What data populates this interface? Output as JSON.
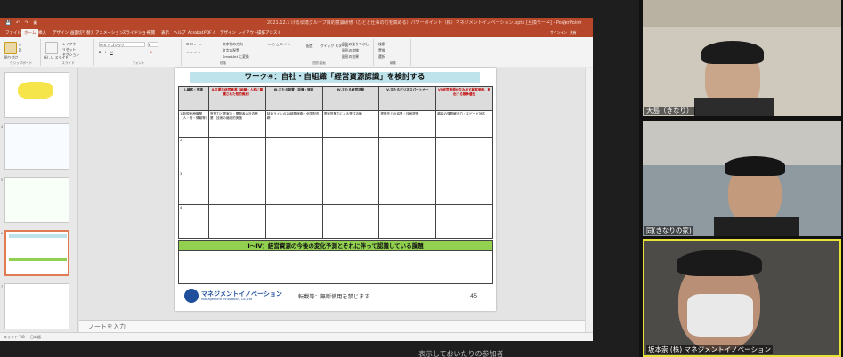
{
  "ppt": {
    "title_text": "2021.12.1 ける伝達グループ目的意識研修（ひとと仕事の力を高める）パワーポイント（株）マネジメントイノベーション.pptx [互換モード] - PowerPoint",
    "tabs": [
      "ファイル",
      "ホーム",
      "挿入",
      "デザイン",
      "画面切り替え",
      "アニメーション",
      "スライドショー",
      "校閲",
      "表示",
      "ヘルプ",
      "Acrobat",
      "PDF 4",
      "デザイン",
      "レイアウト",
      "操作アシスト"
    ],
    "active_tab": "ホーム",
    "ribbon": {
      "paste": "貼り付け",
      "clipboard": "クリップボード",
      "new_slide": "新しい スライド",
      "layout": "レイアウト",
      "reset": "リセット",
      "section": "セクション",
      "slides_group": "スライド",
      "font_name": "ＭＳ Ｐゴシック",
      "font_size": "6",
      "font_group": "フォント",
      "paragraph_group": "段落",
      "text_direction": "文字列の方向",
      "align_text": "文字の配置",
      "smartart": "SmartArt に変換",
      "drawing_group": "図形描画",
      "arrange": "配置",
      "quick_styles": "クイック スタイル",
      "shape_fill": "図形の塗りつぶし",
      "shape_outline": "図形の枠線",
      "shape_effects": "図形の効果",
      "find": "検索",
      "replace": "置換",
      "select": "選択",
      "editing_group": "編集",
      "share": "共有",
      "signin": "サインイン"
    },
    "notes_placeholder": "ノートを入力",
    "status": {
      "slide_info": "スライド 7/8",
      "lang": "日本語"
    },
    "thumb_numbers": [
      "4",
      "5",
      "6",
      "7",
      "8"
    ]
  },
  "slide": {
    "title": "ワーク④：自社・自組織「経営資源認識」を検討する",
    "headers": [
      {
        "text": "Ⅰ.顧客・市場",
        "red": false
      },
      {
        "text": "Ⅱ.主要な経営資源（組織・人材に蓄積された知的資産）",
        "red": true
      },
      {
        "text": "Ⅲ.主たる装置・設備・施設",
        "red": false
      },
      {
        "text": "Ⅳ.主たる経営活動",
        "red": false
      },
      {
        "text": "Ⅴ.主たるビジネスパートナー",
        "red": false
      },
      {
        "text": "Ⅵ.経営資源が生み出す顧客価値、創出する競争優位",
        "red": true
      }
    ],
    "example_row": [
      "1.新規医療機関（人・物・情報等）",
      "営業力と提案力・開発者の社内営業・技術の継続的実施",
      "製造ラインの24時間稼働・全国配送網",
      "提案営業力による受注活動",
      "提携先との協業・技術提携",
      "顧客の課題解決力・スピード対応"
    ],
    "row_numbers": [
      "2.",
      "3.",
      "4."
    ],
    "band_text": "Ⅰ～Ⅳ：経営資源の今後の変化予測とそれに伴って認識している課題",
    "logo_name": "マネジメントイノベーション",
    "logo_sub": "Management Innovation, Co.,Ltd",
    "copyright": "転載等：無断使用を禁じます",
    "page_number": "45"
  },
  "caption": "表示しておいたりの参加者",
  "participants": [
    {
      "name": "大島（きなり）"
    },
    {
      "name": "同(きなりの家)"
    },
    {
      "name": "坂本崇 (株) マネジメントイノベーション"
    }
  ],
  "colors": {
    "ppt_accent": "#b7472a",
    "band_green": "#92d050",
    "title_band": "#bfe3ea",
    "active_speaker": "#e8e236"
  }
}
